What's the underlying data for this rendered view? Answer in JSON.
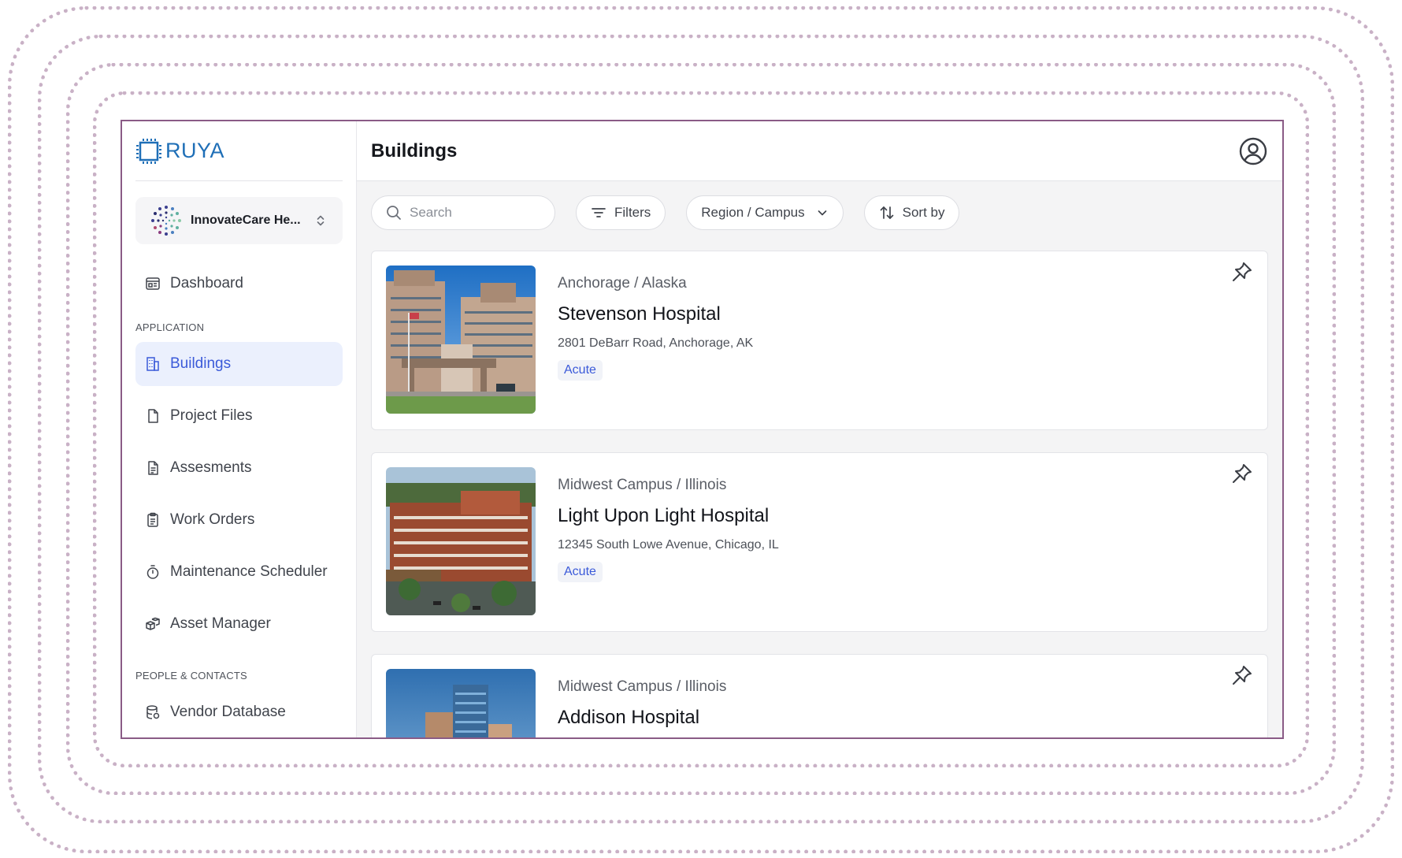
{
  "app": {
    "name": "RUYA"
  },
  "org": {
    "name": "InnovateCare He..."
  },
  "sidebar": {
    "top_items": [
      {
        "label": "Dashboard",
        "icon": "dashboard-icon"
      }
    ],
    "sections": [
      {
        "label": "APPLICATION",
        "items": [
          {
            "label": "Buildings",
            "icon": "buildings-icon",
            "active": true
          },
          {
            "label": "Project Files",
            "icon": "file-icon"
          },
          {
            "label": "Assesments",
            "icon": "document-icon"
          },
          {
            "label": "Work Orders",
            "icon": "clipboard-icon"
          },
          {
            "label": "Maintenance Scheduler",
            "icon": "stopwatch-icon"
          },
          {
            "label": "Asset Manager",
            "icon": "boxes-icon"
          }
        ]
      },
      {
        "label": "PEOPLE & CONTACTS",
        "items": [
          {
            "label": "Vendor Database",
            "icon": "database-icon"
          }
        ]
      }
    ]
  },
  "header": {
    "title": "Buildings"
  },
  "toolbar": {
    "search_placeholder": "Search",
    "filters_label": "Filters",
    "region_label": "Region / Campus",
    "sort_label": "Sort by"
  },
  "buildings": [
    {
      "region": "Anchorage / Alaska",
      "name": "Stevenson Hospital",
      "address": "2801 DeBarr Road, Anchorage, AK",
      "tag": "Acute"
    },
    {
      "region": "Midwest Campus / Illinois",
      "name": "Light Upon Light Hospital",
      "address": "12345 South Lowe Avenue, Chicago, IL",
      "tag": "Acute"
    },
    {
      "region": "Midwest Campus / Illinois",
      "name": "Addison Hospital",
      "address": "",
      "tag": ""
    }
  ],
  "colors": {
    "accent": "#3b5ad9",
    "active_bg": "#ebf0fd",
    "logo": "#1f6fb7",
    "frame": "#8a5b86"
  }
}
